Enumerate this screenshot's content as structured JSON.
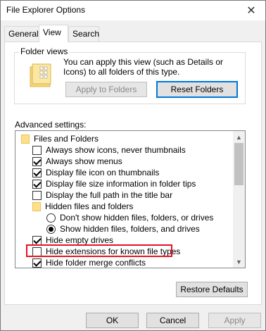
{
  "window": {
    "title": "File Explorer Options",
    "close_glyph": "✕"
  },
  "tabs": [
    {
      "label": "General"
    },
    {
      "label": "View"
    },
    {
      "label": "Search"
    }
  ],
  "folder_views": {
    "title": "Folder views",
    "description": "You can apply this view (such as Details or Icons) to all folders of this type.",
    "apply_button": "Apply to Folders",
    "reset_button": "Reset Folders"
  },
  "advanced": {
    "label": "Advanced settings:",
    "items": [
      {
        "type": "folder",
        "label": "Files and Folders"
      },
      {
        "type": "checkbox",
        "checked": false,
        "label": "Always show icons, never thumbnails"
      },
      {
        "type": "checkbox",
        "checked": true,
        "label": "Always show menus"
      },
      {
        "type": "checkbox",
        "checked": true,
        "label": "Display file icon on thumbnails"
      },
      {
        "type": "checkbox",
        "checked": true,
        "label": "Display file size information in folder tips"
      },
      {
        "type": "checkbox",
        "checked": false,
        "label": "Display the full path in the title bar"
      },
      {
        "type": "folder",
        "label": "Hidden files and folders"
      },
      {
        "type": "radio",
        "checked": false,
        "label": "Don't show hidden files, folders, or drives"
      },
      {
        "type": "radio",
        "checked": true,
        "label": "Show hidden files, folders, and drives"
      },
      {
        "type": "checkbox",
        "checked": true,
        "label": "Hide empty drives"
      },
      {
        "type": "checkbox",
        "checked": false,
        "label": "Hide extensions for known file types"
      },
      {
        "type": "checkbox",
        "checked": true,
        "label": "Hide folder merge conflicts"
      }
    ],
    "restore_button": "Restore Defaults"
  },
  "footer": {
    "ok": "OK",
    "cancel": "Cancel",
    "apply": "Apply"
  },
  "colors": {
    "highlight": "#e81123",
    "focus": "#0078d7"
  }
}
